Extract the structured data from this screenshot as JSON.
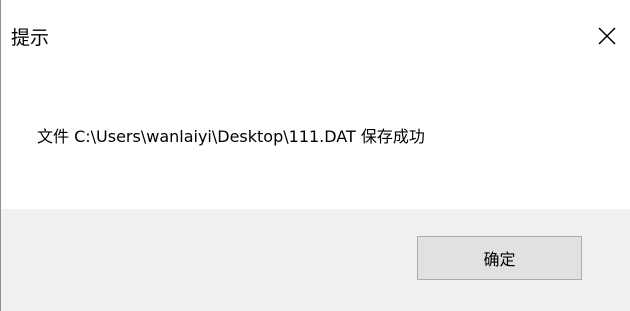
{
  "dialog": {
    "title": "提示",
    "close_icon": "close-icon",
    "message": "文件 C:\\Users\\wanlaiyi\\Desktop\\111.DAT 保存成功",
    "ok_label": "确定"
  }
}
